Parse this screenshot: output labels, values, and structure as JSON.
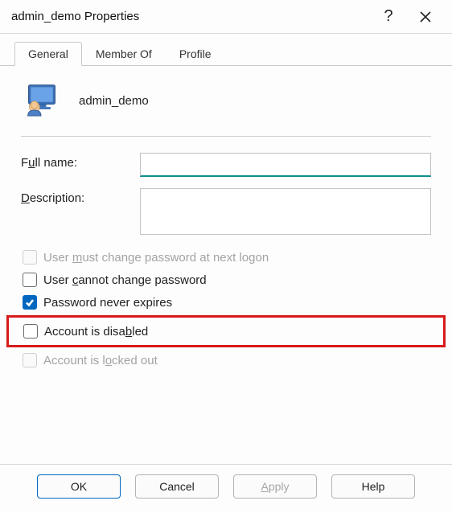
{
  "titlebar": {
    "title": "admin_demo Properties",
    "help_symbol": "?",
    "close_label": "Close"
  },
  "tabs": {
    "general": "General",
    "member_of": "Member Of",
    "profile": "Profile"
  },
  "header": {
    "username": "admin_demo"
  },
  "form": {
    "full_name_label_pre": "F",
    "full_name_label_ul": "u",
    "full_name_label_post": "ll name:",
    "full_name_value": "",
    "description_label_ul": "D",
    "description_label_post": "escription:",
    "description_value": ""
  },
  "checks": {
    "must_change_pre": "User ",
    "must_change_ul": "m",
    "must_change_post": "ust change password at next logon",
    "cannot_change_pre": "User ",
    "cannot_change_ul": "c",
    "cannot_change_post": "annot change password",
    "never_expires_pre": "Password never expires",
    "disabled_pre": "Account is disa",
    "disabled_ul": "b",
    "disabled_post": "led",
    "locked_pre": "Account is l",
    "locked_ul": "o",
    "locked_post": "cked out"
  },
  "buttons": {
    "ok": "OK",
    "cancel": "Cancel",
    "apply_ul": "A",
    "apply_post": "pply",
    "help": "Help"
  }
}
